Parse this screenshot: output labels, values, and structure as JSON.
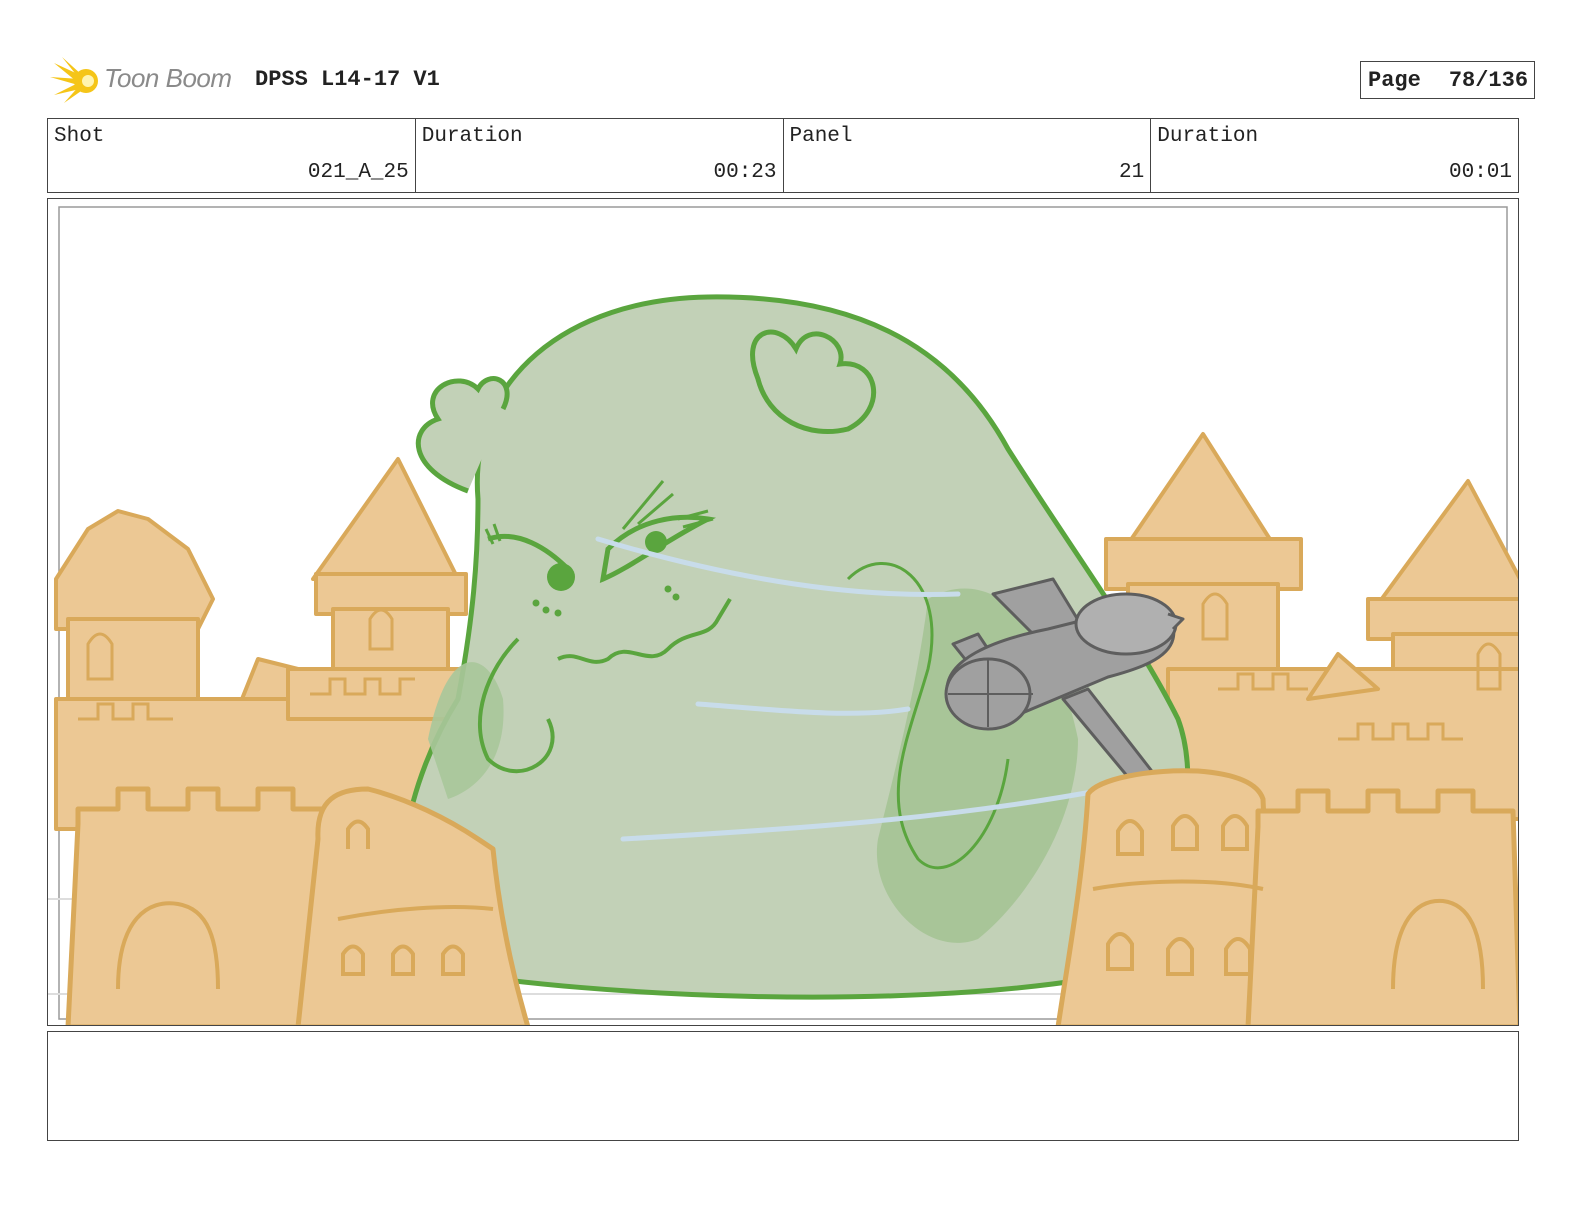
{
  "header": {
    "logo_text": "Toon Boom",
    "project_title": "DPSS L14-17 V1",
    "page_label": "Page",
    "page_number": "78/136"
  },
  "info": {
    "shot_label": "Shot",
    "shot_value": "021_A_25",
    "shot_duration_label": "Duration",
    "shot_duration_value": "00:23",
    "panel_label": "Panel",
    "panel_value": "21",
    "panel_duration_label": "Duration",
    "panel_duration_value": "00:01"
  },
  "colors": {
    "sand": "#ecc894",
    "sand_line": "#d9a95a",
    "blob_fill": "#c2d1b7",
    "blob_line": "#5aa53e",
    "plane": "#9a9a9a",
    "logo_yellow": "#f5c518"
  }
}
